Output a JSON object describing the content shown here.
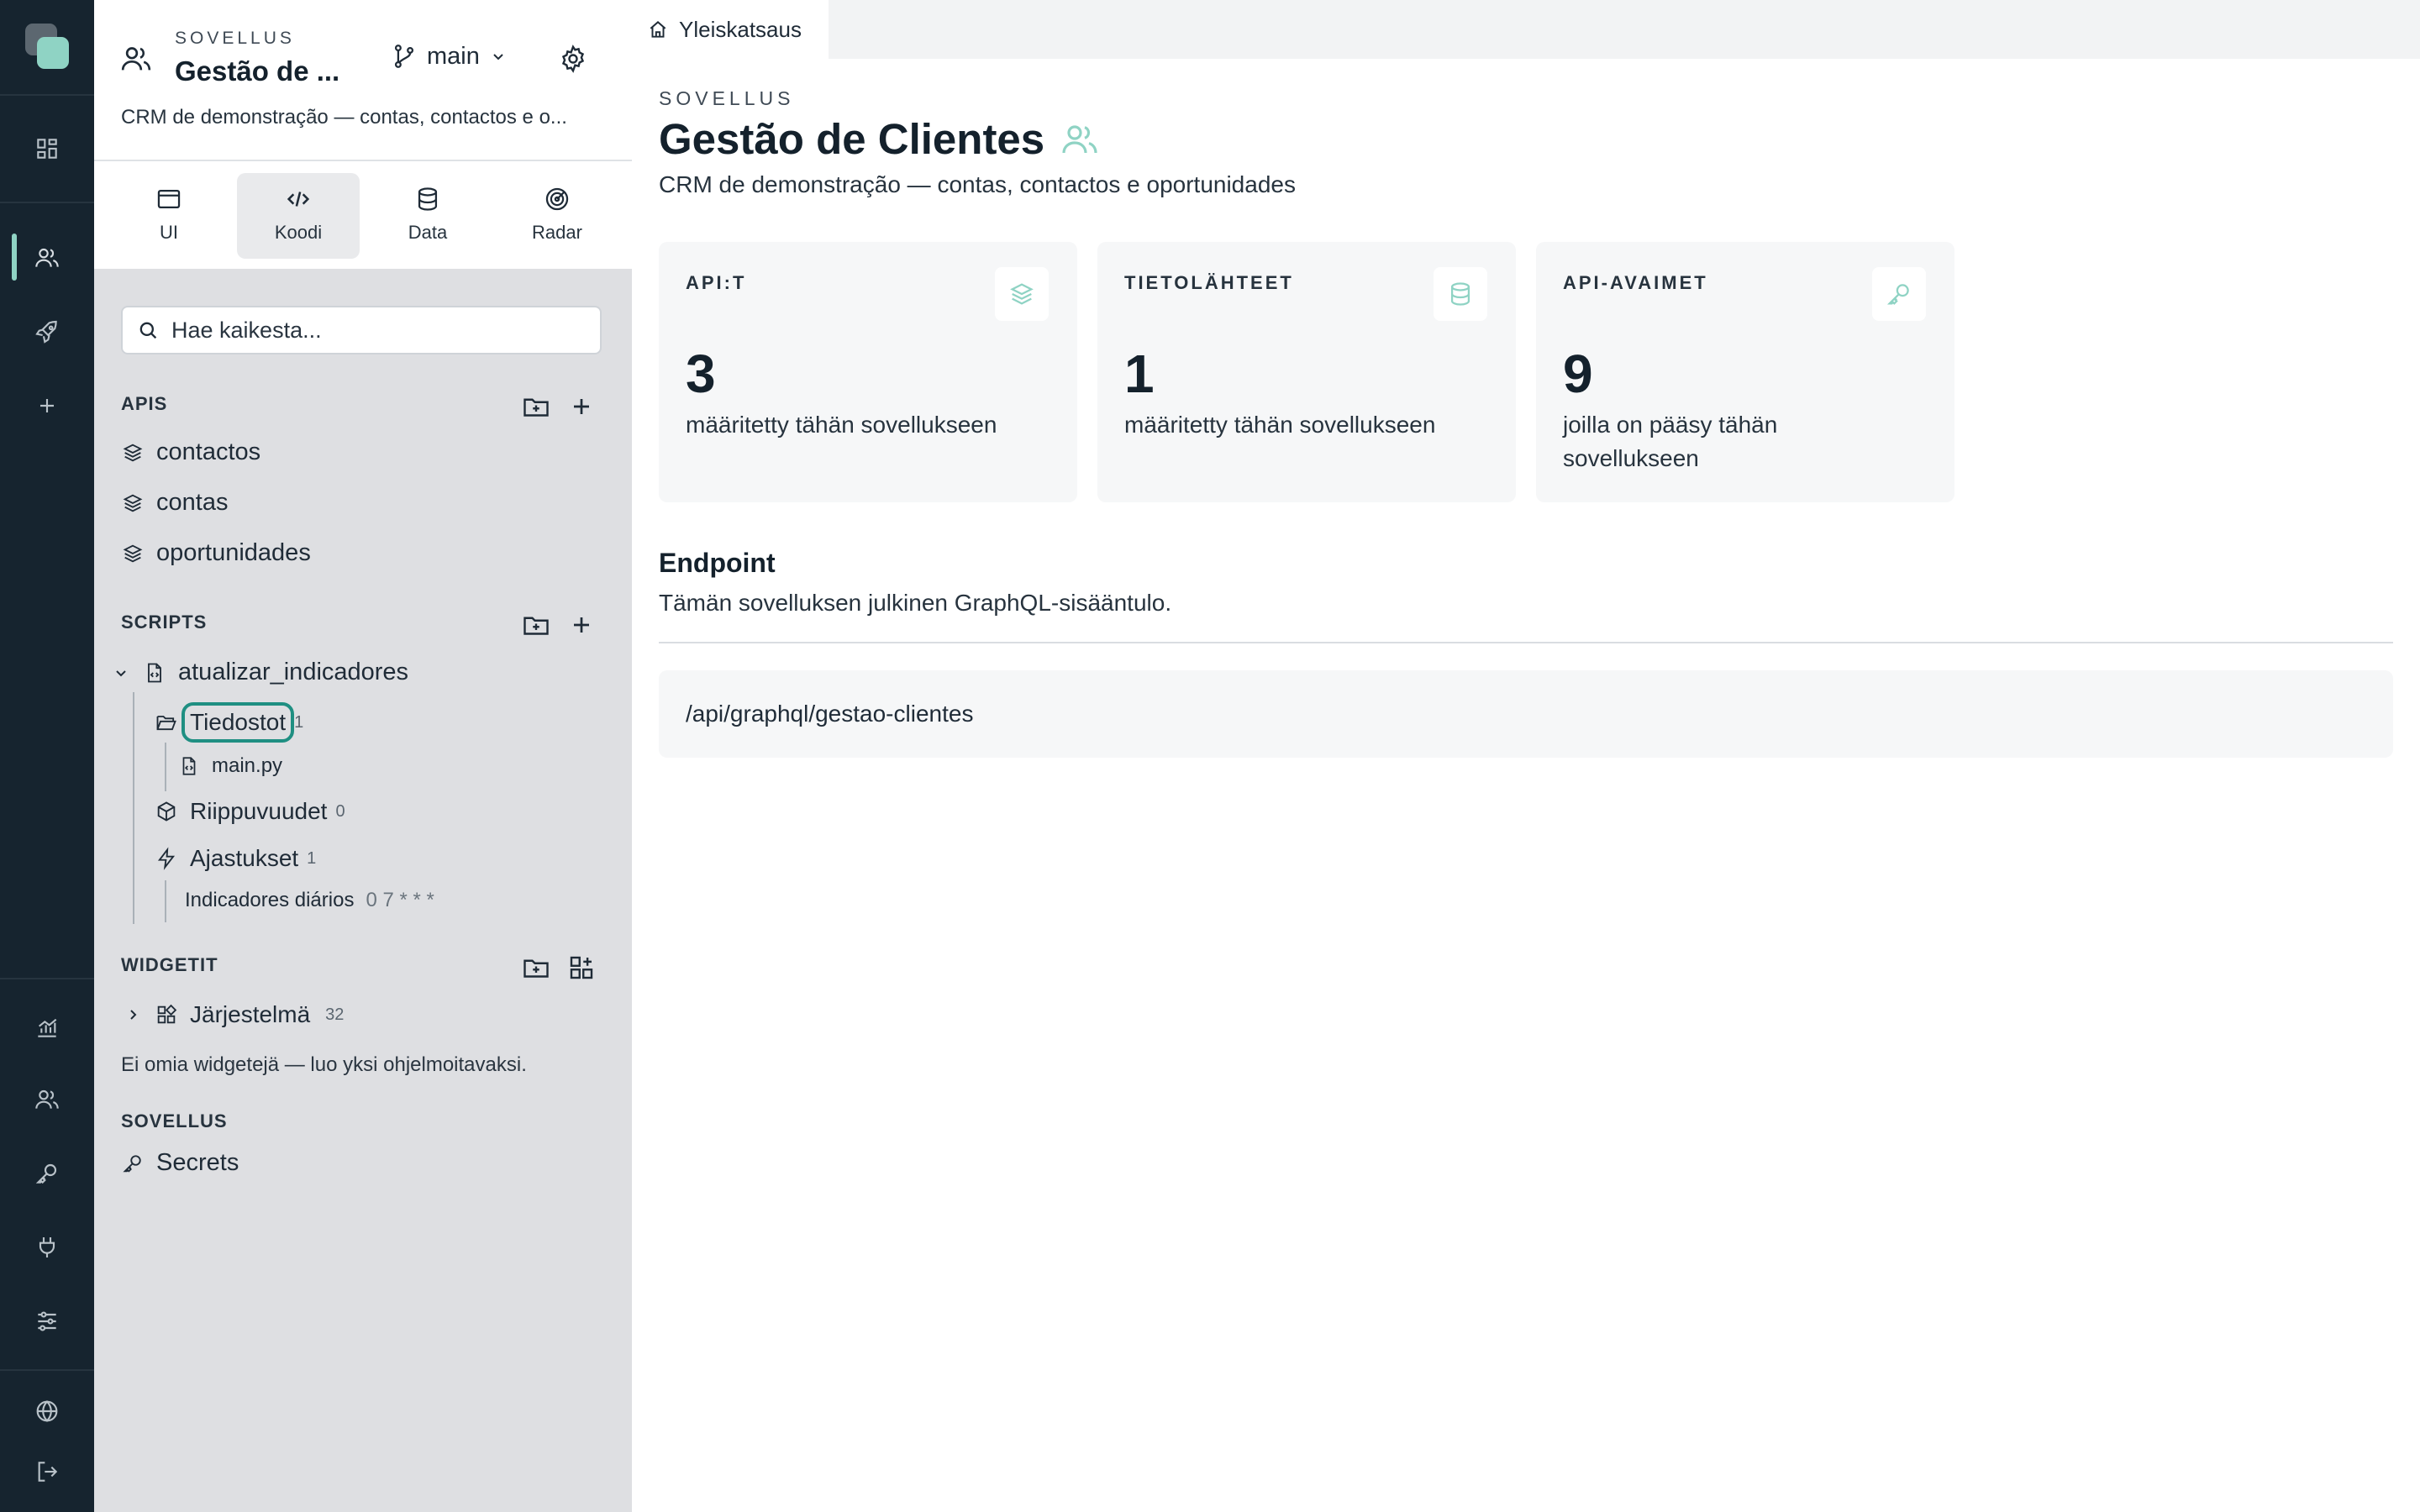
{
  "colors": {
    "rail_bg": "#16242f",
    "accent": "#8fd3c4",
    "focus_ring": "#1f8f82",
    "sidebar_bg": "#dedfe2"
  },
  "rail": {
    "items": [
      {
        "name": "dashboard-icon"
      },
      {
        "name": "users-icon",
        "active": true
      },
      {
        "name": "rocket-icon"
      },
      {
        "name": "plus-icon"
      },
      {
        "name": "chart-icon"
      },
      {
        "name": "users-icon"
      },
      {
        "name": "key-icon"
      },
      {
        "name": "plug-icon"
      },
      {
        "name": "sliders-icon"
      },
      {
        "name": "globe-icon"
      },
      {
        "name": "logout-icon"
      }
    ]
  },
  "sidebar": {
    "app_eyebrow": "SOVELLUS",
    "app_title": "Gestão de ...",
    "branch": "main",
    "app_description": "CRM de demonstração — contas, contactos e o...",
    "tabs": [
      {
        "label": "UI",
        "icon": "browser-icon"
      },
      {
        "label": "Koodi",
        "icon": "code-icon",
        "active": true
      },
      {
        "label": "Data",
        "icon": "database-icon"
      },
      {
        "label": "Radar",
        "icon": "radar-icon"
      }
    ],
    "search_placeholder": "Hae kaikesta...",
    "apis": {
      "title": "APIS",
      "items": [
        "contactos",
        "contas",
        "oportunidades"
      ]
    },
    "scripts": {
      "title": "SCRIPTS",
      "script_name": "atualizar_indicadores",
      "files_label": "Tiedostot",
      "files_count": "1",
      "file_name": "main.py",
      "deps_label": "Riippuvuudet",
      "deps_count": "0",
      "schedules_label": "Ajastukset",
      "schedules_count": "1",
      "schedule_name": "Indicadores diários",
      "schedule_cron": "0 7 * * *"
    },
    "widgets": {
      "title": "WIDGETIT",
      "system_label": "Järjestelmä",
      "system_count": "32",
      "empty_hint": "Ei omia widgetejä — luo yksi ohjelmoitavaksi."
    },
    "app_section": {
      "title": "SOVELLUS",
      "secrets_label": "Secrets"
    }
  },
  "main": {
    "tab_label": "Yleiskatsaus",
    "eyebrow": "SOVELLUS",
    "title": "Gestão de Clientes",
    "description": "CRM de demonstração — contas, contactos e oportunidades",
    "cards": [
      {
        "label": "API:T",
        "value": "3",
        "subtitle": "määritetty tähän sovellukseen",
        "icon": "layers-icon"
      },
      {
        "label": "TIETOLÄHTEET",
        "value": "1",
        "subtitle": "määritetty tähän sovellukseen",
        "icon": "database-icon"
      },
      {
        "label": "API-AVAIMET",
        "value": "9",
        "subtitle": "joilla on pääsy tähän sovellukseen",
        "icon": "key-icon"
      }
    ],
    "endpoint": {
      "title": "Endpoint",
      "description": "Tämän sovelluksen julkinen GraphQL-sisääntulo.",
      "url": "/api/graphql/gestao-clientes"
    }
  }
}
